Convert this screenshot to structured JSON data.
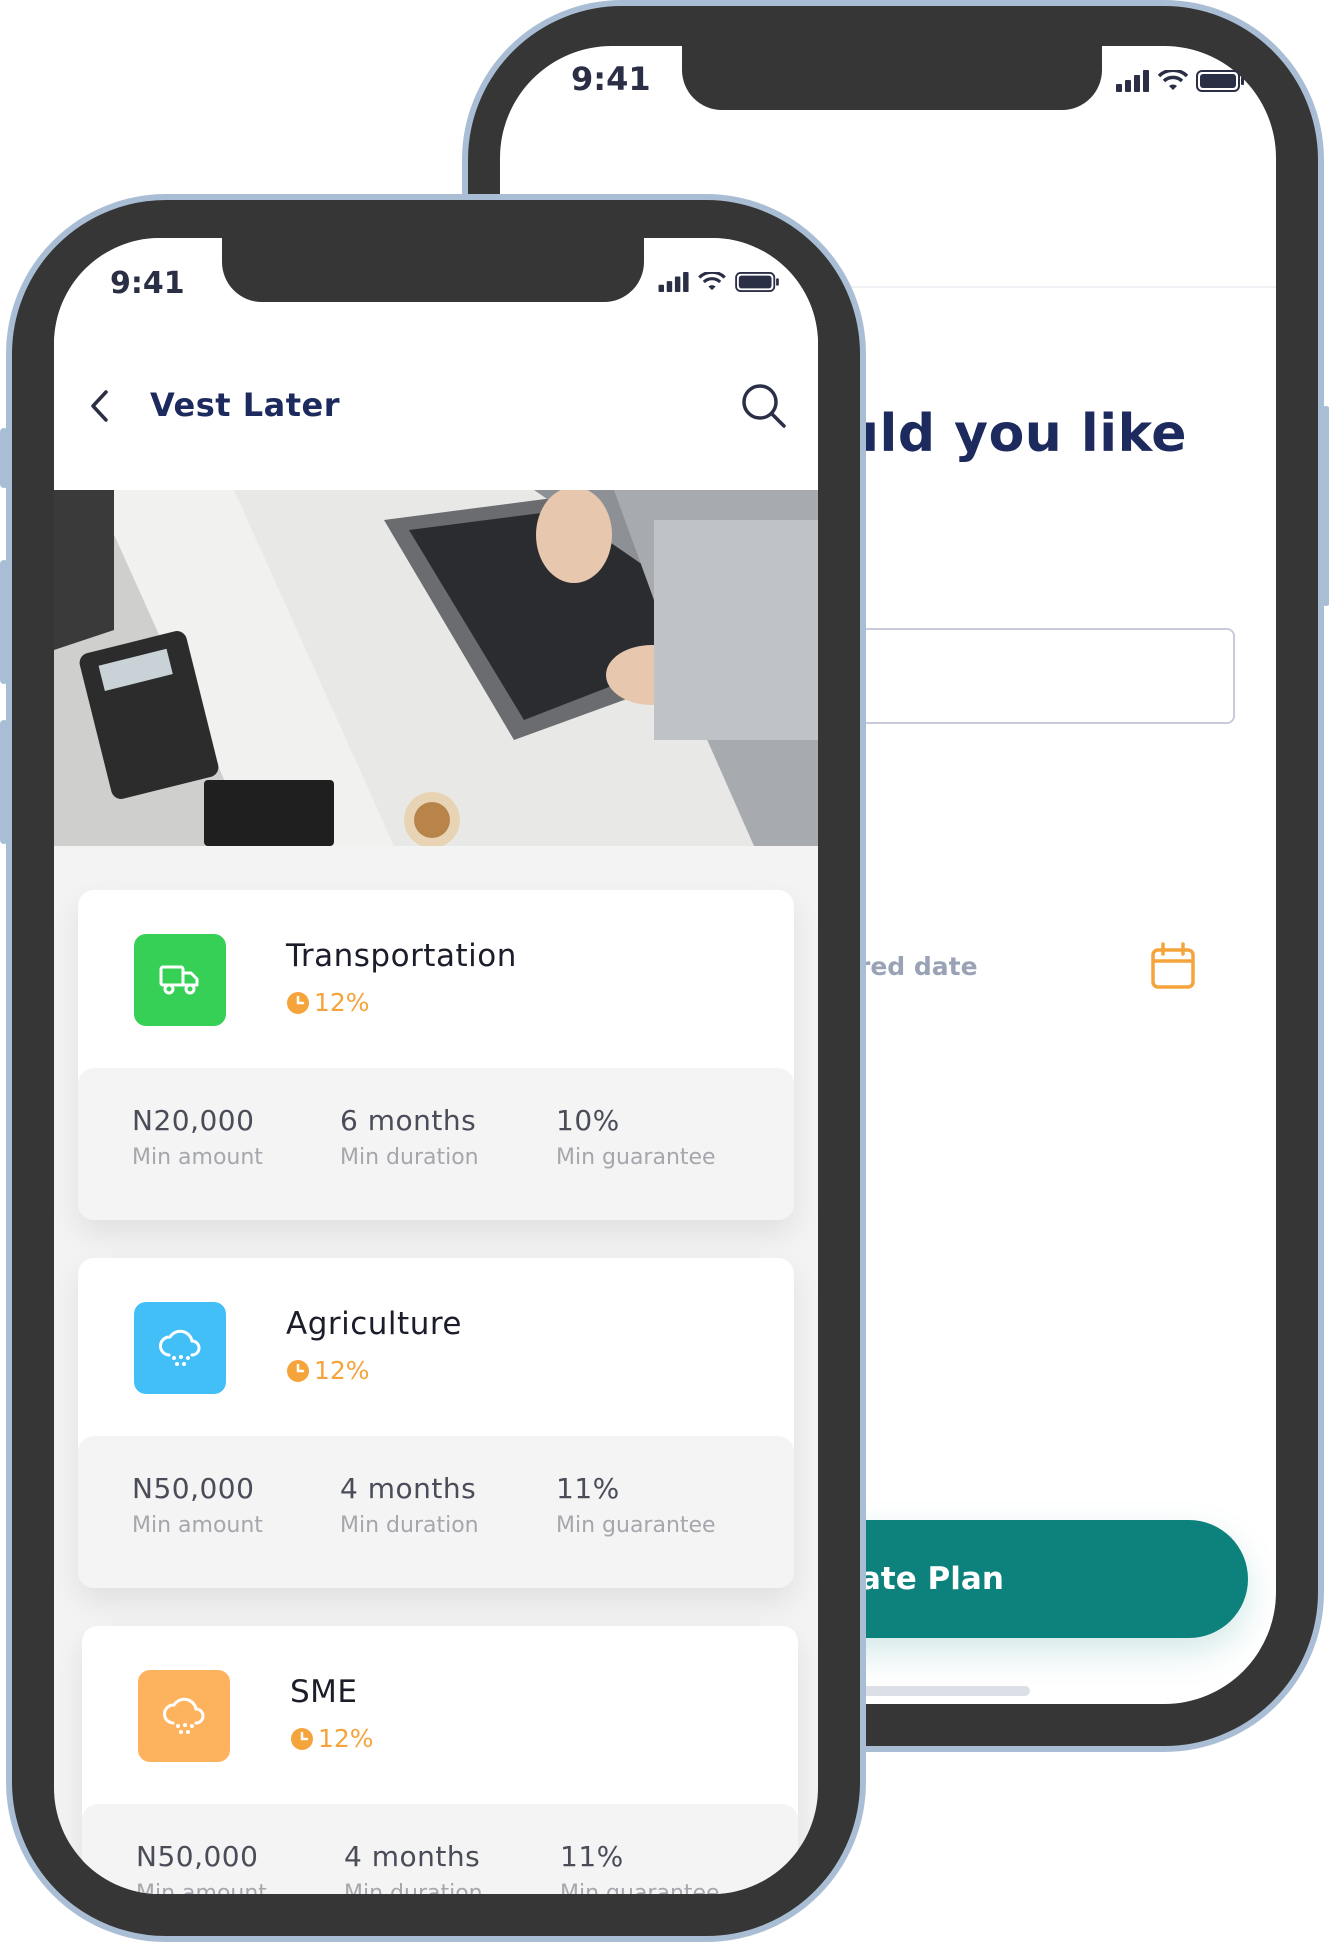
{
  "back_phone": {
    "time": "9:41",
    "heading": "uld you like",
    "date_placeholder": "red date",
    "button_label": "ate Plan"
  },
  "front_phone": {
    "time": "9:41",
    "title": "Vest Later",
    "cards": [
      {
        "name": "Transportation",
        "rate": "12%",
        "icon": "truck-icon",
        "color": "#36d057",
        "stats": [
          {
            "value": "N20,000",
            "label": "Min amount"
          },
          {
            "value": "6 months",
            "label": "Min duration"
          },
          {
            "value": "10%",
            "label": "Min guarantee"
          }
        ]
      },
      {
        "name": "Agriculture",
        "rate": "12%",
        "icon": "cloud-rain-icon",
        "color": "#41bff6",
        "stats": [
          {
            "value": "N50,000",
            "label": "Min amount"
          },
          {
            "value": "4 months",
            "label": "Min duration"
          },
          {
            "value": "11%",
            "label": "Min guarantee"
          }
        ]
      },
      {
        "name": "SME",
        "rate": "12%",
        "icon": "cloud-rain-icon",
        "color": "#fdb35e",
        "stats": [
          {
            "value": "N50,000",
            "label": "Min amount"
          },
          {
            "value": "4 months",
            "label": "Min duration"
          },
          {
            "value": "11%",
            "label": "Min guarantee"
          }
        ]
      }
    ]
  },
  "colors": {
    "navy": "#1d2a5e",
    "teal": "#0d827d",
    "orange": "#f5a43b",
    "frame": "#a9bed4",
    "bezel": "#363636"
  }
}
